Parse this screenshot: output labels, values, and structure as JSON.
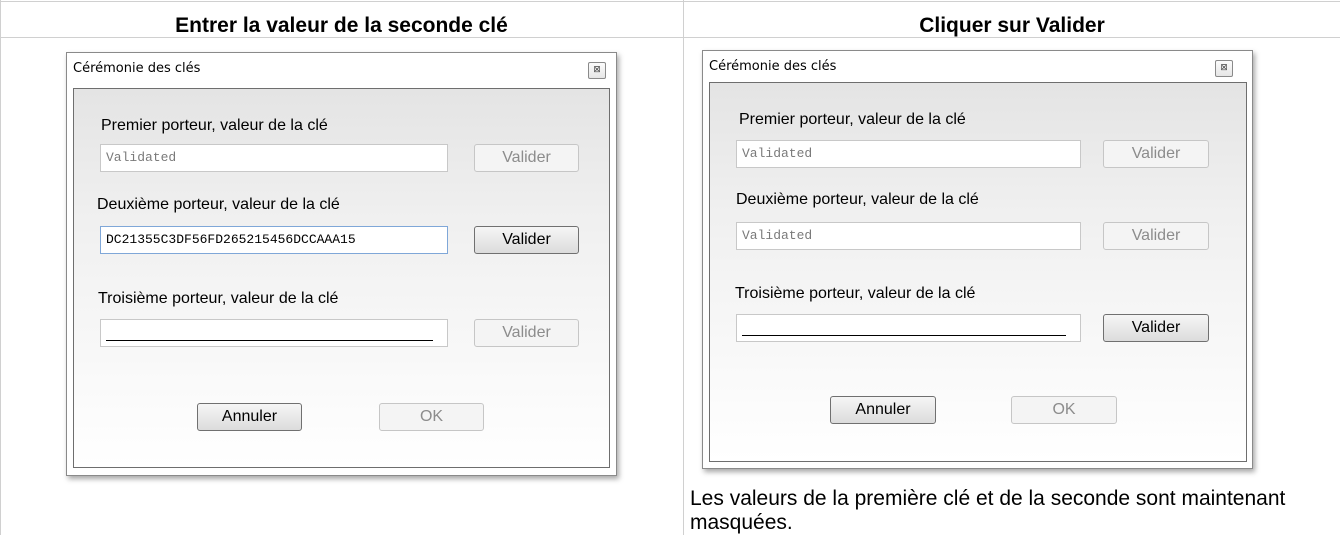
{
  "columns": [
    {
      "heading": "Entrer la valeur de la seconde clé",
      "dialog": {
        "title": "Cérémonie des clés",
        "close_glyph": "⊠",
        "rows": [
          {
            "label": "Premier porteur, valeur de la clé",
            "value": "Validated",
            "state": "disabled",
            "button": "Valider",
            "button_enabled": false
          },
          {
            "label": "Deuxième porteur, valeur de la clé",
            "value": "DC21355C3DF56FD265215456DCCAAA15",
            "state": "active",
            "button": "Valider",
            "button_enabled": true
          },
          {
            "label": "Troisième porteur, valeur de la clé",
            "value": "",
            "state": "masked",
            "button": "Valider",
            "button_enabled": false
          }
        ],
        "cancel_label": "Annuler",
        "ok_label": "OK"
      }
    },
    {
      "heading": "Cliquer sur Valider",
      "dialog": {
        "title": "Cérémonie des clés",
        "close_glyph": "⊠",
        "rows": [
          {
            "label": "Premier porteur, valeur de la clé",
            "value": "Validated",
            "state": "disabled",
            "button": "Valider",
            "button_enabled": false
          },
          {
            "label": "Deuxième porteur, valeur de la clé",
            "value": "Validated",
            "state": "disabled",
            "button": "Valider",
            "button_enabled": false
          },
          {
            "label": "Troisième porteur, valeur de la clé",
            "value": "",
            "state": "masked",
            "button": "Valider",
            "button_enabled": true
          }
        ],
        "cancel_label": "Annuler",
        "ok_label": "OK"
      }
    }
  ],
  "caption": "Les valeurs de la première clé et de la seconde sont maintenant masquées."
}
